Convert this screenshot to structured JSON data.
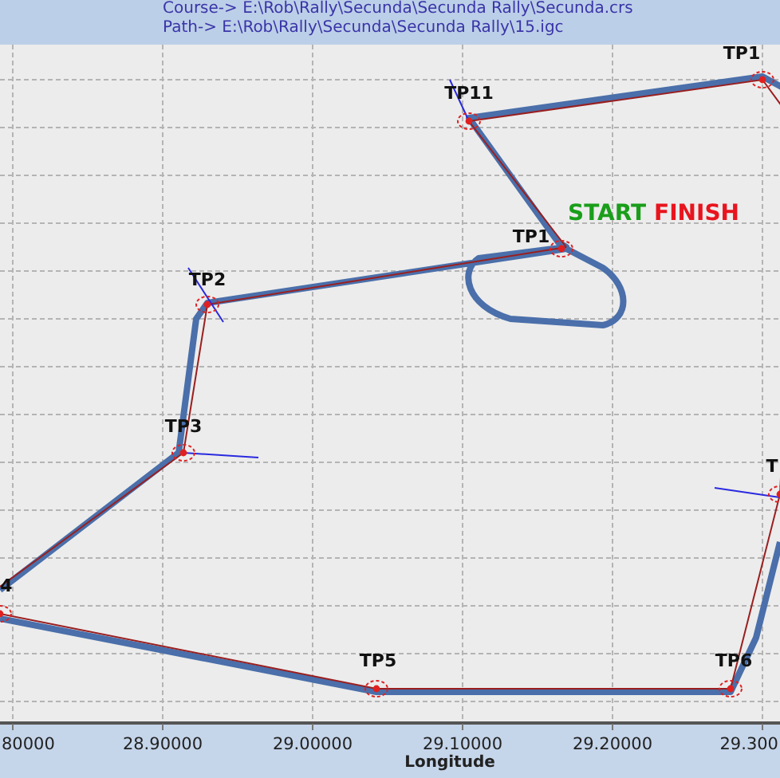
{
  "header": {
    "course": "Course-> E:\\Rob\\Rally\\Secunda\\Secunda Rally\\Secunda.crs",
    "path": "Path-> E:\\Rob\\Rally\\Secunda\\Secunda Rally\\15.igc"
  },
  "map": {
    "waypoints": [
      {
        "label": "TP11"
      },
      {
        "label": "TP1"
      },
      {
        "label": "TP1"
      },
      {
        "label": "TP2"
      },
      {
        "label": "TP3"
      },
      {
        "label": "4"
      },
      {
        "label": "TP5"
      },
      {
        "label": "TP6"
      },
      {
        "label": "T"
      }
    ],
    "start_finish": [
      {
        "label": "START",
        "color": "#1a9e1a"
      },
      {
        "label": "FINISH",
        "color": "#e8141e"
      }
    ],
    "x_ticks": [
      "80000",
      "28.90000",
      "29.00000",
      "29.10000",
      "29.20000",
      "29.300"
    ],
    "xlabel": "Longitude"
  }
}
